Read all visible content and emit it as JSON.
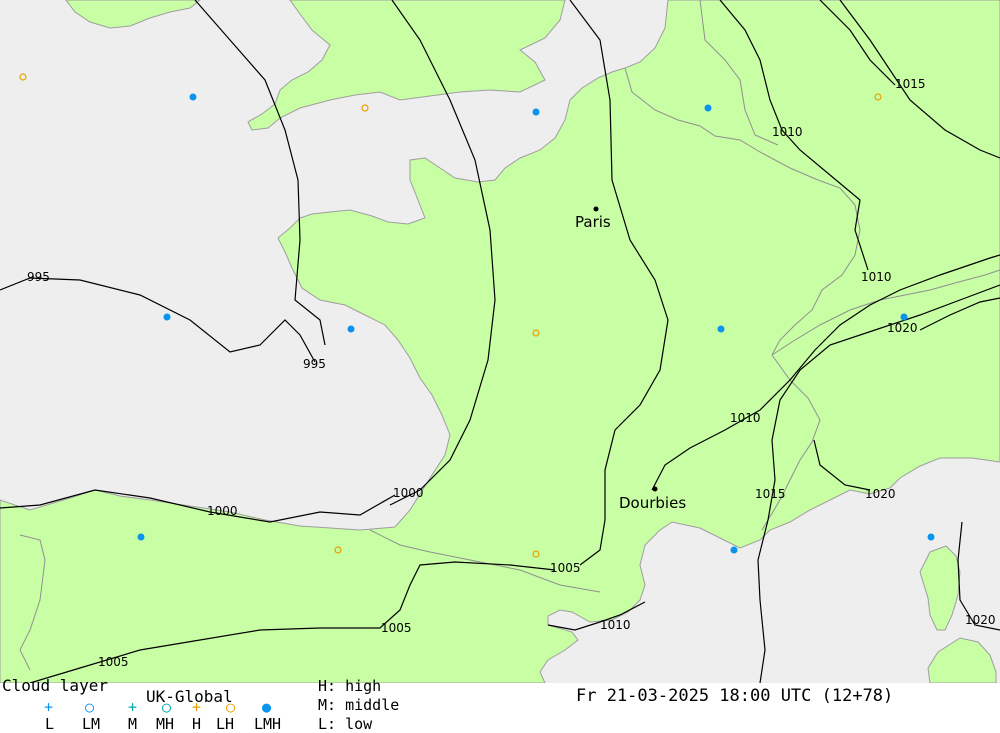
{
  "colors": {
    "sea": "#eeeeee",
    "land": "#c8fea4",
    "coast": "#9e9e9e",
    "border": "#909090",
    "isobar": "#000000",
    "mark_blue": "#0a94ee",
    "mark_orange": "#e8a000",
    "mark_cyan": "#00a8a8"
  },
  "map": {
    "isobar_labels": [
      "995",
      "995",
      "1000",
      "1000",
      "1005",
      "1005",
      "1005",
      "1010",
      "1010",
      "1010",
      "1010",
      "1015",
      "1015",
      "1020",
      "1020",
      "1020"
    ],
    "cities": [
      {
        "name": "Paris"
      },
      {
        "name": "Dourbies"
      }
    ],
    "markers": [
      {
        "type": "LMH",
        "color": "blue"
      },
      {
        "type": "LMH",
        "color": "blue"
      },
      {
        "type": "LMH",
        "color": "blue"
      },
      {
        "type": "LMH",
        "color": "blue"
      },
      {
        "type": "LMH",
        "color": "blue"
      },
      {
        "type": "LMH",
        "color": "blue"
      },
      {
        "type": "LMH",
        "color": "blue"
      },
      {
        "type": "LMH",
        "color": "blue"
      },
      {
        "type": "LMH",
        "color": "blue"
      },
      {
        "type": "LMH",
        "color": "blue"
      },
      {
        "type": "LH",
        "color": "orange"
      },
      {
        "type": "LH",
        "color": "orange"
      },
      {
        "type": "LH",
        "color": "orange"
      },
      {
        "type": "LH",
        "color": "orange"
      },
      {
        "type": "LH",
        "color": "orange"
      },
      {
        "type": "LH",
        "color": "orange"
      }
    ]
  },
  "legend": {
    "title": "Cloud layer",
    "model": "UK-Global",
    "symbols": [
      "L",
      "LM",
      "M",
      "MH",
      "H",
      "LH",
      "LMH"
    ],
    "levels": [
      "H: high",
      "M: middle",
      "L: low"
    ],
    "timestamp": "Fr 21-03-2025 18:00 UTC (12+78)"
  }
}
